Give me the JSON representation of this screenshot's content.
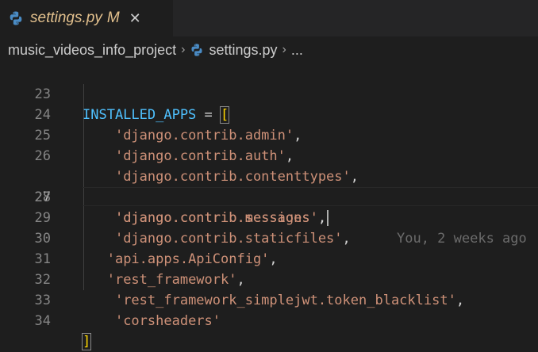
{
  "tab": {
    "icon": "python-icon",
    "filename": "settings.py",
    "badge": "M",
    "close": "✕"
  },
  "breadcrumb": {
    "folder": "music_videos_info_project",
    "separator": "›",
    "file": "settings.py",
    "more": "..."
  },
  "code": {
    "lines": [
      {
        "num": "23",
        "var": "INSTALLED_APPS",
        "op": " = ",
        "bracket": "["
      },
      {
        "num": "24",
        "str": "'django.contrib.admin'",
        "punc": ","
      },
      {
        "num": "25",
        "str": "'django.contrib.auth'",
        "punc": ","
      },
      {
        "num": "26",
        "str": "'django.contrib.contenttypes'",
        "punc": ","
      },
      {
        "num": "27",
        "str": "'django.contrib.sessions'",
        "punc": ",",
        "blame": "You, 2 weeks ago"
      },
      {
        "num": "28",
        "str": "'django.contrib.messages'",
        "punc": ","
      },
      {
        "num": "29",
        "str": "'django.contrib.staticfiles'",
        "punc": ","
      },
      {
        "num": "30",
        "str": "'api.apps.ApiConfig'",
        "punc": ","
      },
      {
        "num": "31",
        "str": "'rest_framework'",
        "punc": ","
      },
      {
        "num": "32",
        "str": "'rest_framework_simplejwt.token_blacklist'",
        "punc": ","
      },
      {
        "num": "33",
        "str": "'corsheaders'",
        "punc": ""
      },
      {
        "num": "34",
        "bracket": "]"
      }
    ],
    "active_line": "27"
  },
  "colors": {
    "background": "#1e1e1e",
    "variable": "#4fc1ff",
    "string": "#ce9178",
    "bracket": "#ffd700",
    "modified": "#e2c08d"
  }
}
